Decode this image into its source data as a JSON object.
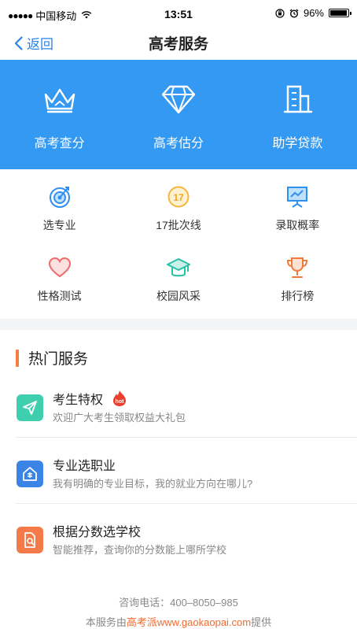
{
  "status": {
    "carrier": "中国移动",
    "time": "13:51",
    "battery": "96%",
    "battery_level": 0.96
  },
  "nav": {
    "back_label": "返回",
    "title": "高考服务"
  },
  "banner": [
    {
      "label": "高考查分",
      "icon": "crown-icon"
    },
    {
      "label": "高考估分",
      "icon": "diamond-icon"
    },
    {
      "label": "助学贷款",
      "icon": "building-icon"
    }
  ],
  "grid": [
    {
      "label": "选专业",
      "icon": "target-icon"
    },
    {
      "label": "17批次线",
      "icon": "batch-17-icon"
    },
    {
      "label": "录取概率",
      "icon": "chart-board-icon"
    },
    {
      "label": "性格测试",
      "icon": "heart-icon"
    },
    {
      "label": "校园风采",
      "icon": "graduation-cap-icon"
    },
    {
      "label": "排行榜",
      "icon": "trophy-icon"
    }
  ],
  "hot": {
    "title": "热门服务",
    "badge": "hot",
    "items": [
      {
        "name": "考生特权",
        "desc": "欢迎广大考生领取权益大礼包",
        "color": "#3fcfae"
      },
      {
        "name": "专业选职业",
        "desc": "我有明确的专业目标，我的就业方向在哪儿?",
        "color": "#3a84e6"
      },
      {
        "name": "根据分数选学校",
        "desc": "智能推荐，查询你的分数能上哪所学校",
        "color": "#f47a4a"
      }
    ]
  },
  "footer": {
    "phone": "咨询电话：400–8050–985",
    "prefix": "本服务由",
    "brand": "高考派www.gaokaopai.com",
    "suffix": "提供"
  }
}
